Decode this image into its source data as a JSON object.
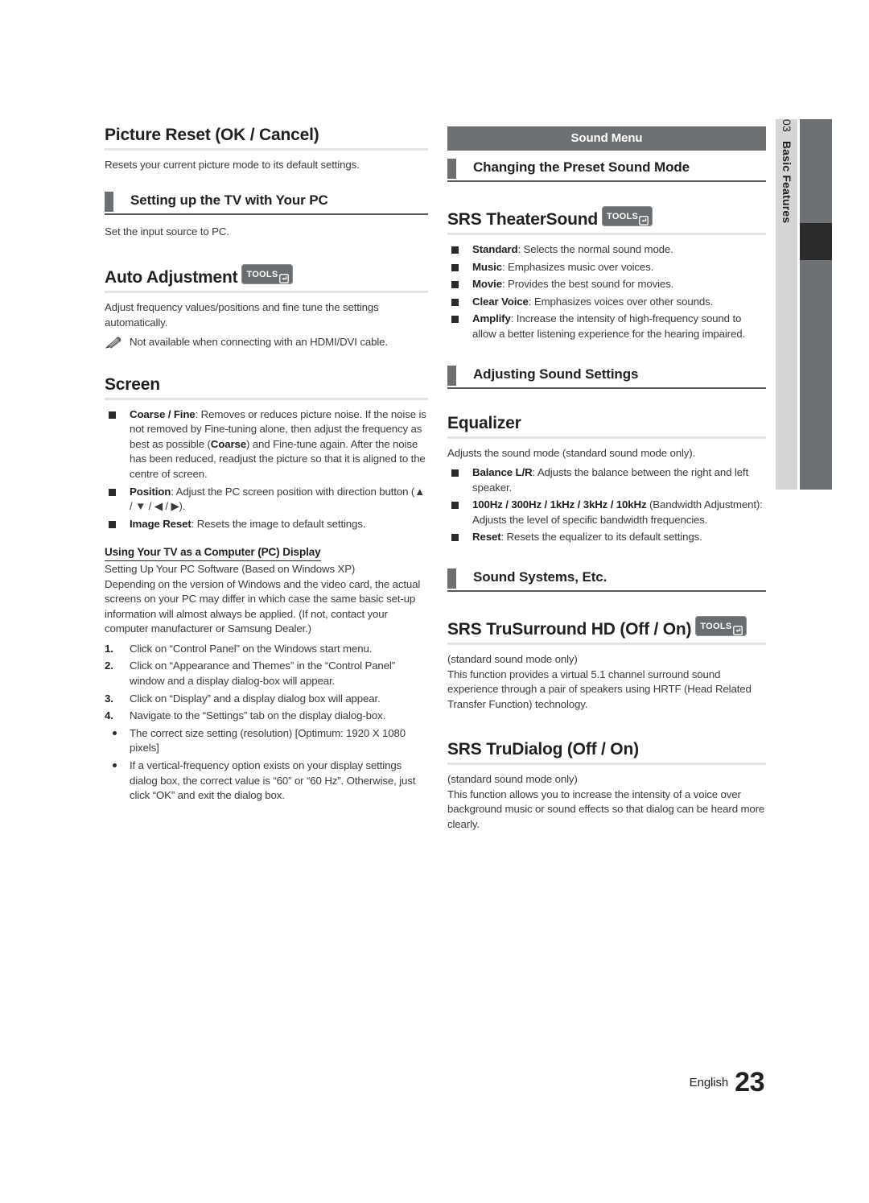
{
  "page": {
    "language": "English",
    "number": "23",
    "chapter_number": "03",
    "chapter_label": "Basic Features"
  },
  "right_banner": {
    "label": "Sound Menu"
  },
  "tools_badge": {
    "label": "TOOLS",
    "icon": "enter-arrow-icon"
  },
  "left_column": {
    "picture_reset": {
      "heading": "Picture Reset (OK / Cancel)",
      "body": "Resets your current picture mode to its default settings."
    },
    "setting_up_tv_pc": {
      "heading": "Setting up the TV with Your PC",
      "body": "Set the input source to PC."
    },
    "auto_adjustment": {
      "heading": "Auto Adjustment",
      "has_tools": true,
      "body": "Adjust frequency values/positions and fine tune the settings automatically.",
      "note": "Not available when connecting with an HDMI/DVI cable."
    },
    "screen": {
      "heading": "Screen",
      "items": [
        {
          "term": "Coarse / Fine",
          "text_before": ": Removes or reduces picture noise. If the noise is not removed by Fine-tuning alone, then adjust the frequency as best as possible (",
          "inline_bold": "Coarse",
          "text_after": ") and Fine-tune again. After the noise has been reduced, readjust the picture so that it is aligned to the centre of screen."
        },
        {
          "term": "Position",
          "text": ": Adjust the PC screen position with direction button (▲ / ▼ / ◀ / ▶)."
        },
        {
          "term": "Image Reset",
          "text": ": Resets the image to default settings."
        }
      ]
    },
    "pc_display": {
      "subheading": "Using Your TV as a Computer (PC) Display",
      "intro_line": "Setting Up Your PC Software (Based on Windows XP)",
      "intro_body": "Depending on the version of Windows and the video card, the actual screens on your PC may differ in which case the same basic set-up information will almost always be applied. (If not, contact your computer manufacturer or Samsung Dealer.)",
      "steps": [
        {
          "num": "1.",
          "text": "Click on “Control Panel” on the Windows start menu."
        },
        {
          "num": "2.",
          "text": "Click on “Appearance and Themes” in the “Control Panel” window and a display dialog-box will appear."
        },
        {
          "num": "3.",
          "text": "Click on “Display” and a display dialog box will appear."
        },
        {
          "num": "4.",
          "text": "Navigate to the “Settings” tab on the display dialog-box."
        }
      ],
      "bullets": [
        "The correct size setting (resolution) [Optimum: 1920 X 1080 pixels]",
        "If a vertical-frequency option exists on your display settings dialog box, the correct value is “60” or “60 Hz”. Otherwise, just click “OK” and exit the dialog box."
      ]
    }
  },
  "right_column": {
    "preset_sound_mode": {
      "heading": "Changing the Preset Sound Mode"
    },
    "srs_theatersound": {
      "heading": "SRS TheaterSound",
      "has_tools": true,
      "items": [
        {
          "term": "Standard",
          "text": ": Selects the normal sound mode."
        },
        {
          "term": "Music",
          "text": ": Emphasizes music over voices."
        },
        {
          "term": "Movie",
          "text": ": Provides the best sound for movies."
        },
        {
          "term": "Clear Voice",
          "text": ": Emphasizes voices over other sounds."
        },
        {
          "term": "Amplify",
          "text": ": Increase the intensity of high-frequency sound to allow a better listening experience for the hearing impaired."
        }
      ]
    },
    "adjusting_sound_settings": {
      "heading": "Adjusting Sound Settings"
    },
    "equalizer": {
      "heading": "Equalizer",
      "body": "Adjusts the sound mode (standard sound mode only).",
      "items": [
        {
          "term": "Balance L/R",
          "text": ": Adjusts the balance between the right and left speaker."
        },
        {
          "term": "100Hz / 300Hz / 1kHz / 3kHz / 10kHz",
          "text": " (Bandwidth Adjustment): Adjusts the level of specific bandwidth frequencies."
        },
        {
          "term": "Reset",
          "text": ": Resets the equalizer to its default settings."
        }
      ]
    },
    "sound_systems_etc": {
      "heading": "Sound Systems, Etc."
    },
    "srs_trusurround": {
      "heading": "SRS TruSurround HD (Off / On)",
      "has_tools": true,
      "note": "(standard sound mode only)",
      "body": "This function provides a virtual 5.1 channel surround sound experience through a pair of speakers using HRTF (Head Related Transfer Function) technology."
    },
    "srs_trudialog": {
      "heading": "SRS TruDialog (Off / On)",
      "has_tools": false,
      "note": "(standard sound mode only)",
      "body": "This function allows you to increase the intensity of a voice over background music or sound effects so that dialog can be heard more clearly."
    }
  },
  "colors": {
    "banner_gray": "#6d7072",
    "tab_light": "#d3d5d6",
    "tab_highlight": "#2b2b2d",
    "rule_light": "#e2e3e4",
    "rule_dark": "#58595b",
    "body_text": "#3b3b3d"
  }
}
